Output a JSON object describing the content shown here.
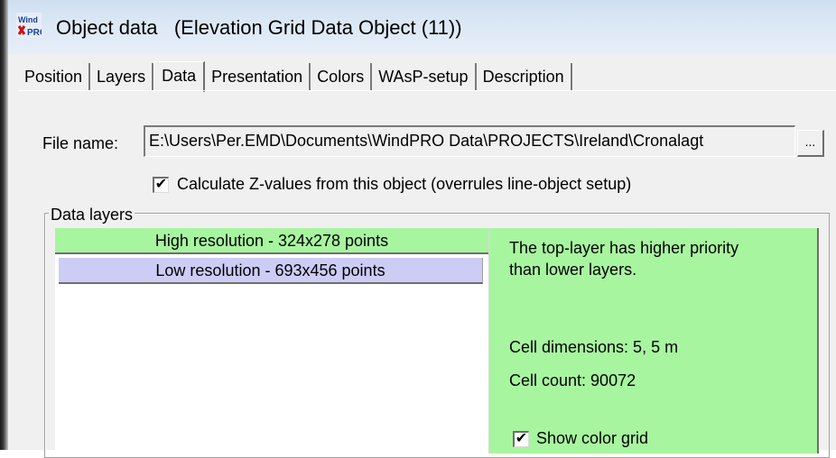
{
  "window": {
    "title": "Object data   (Elevation Grid Data Object (11))",
    "icon": "windpro-app-icon"
  },
  "tabs": [
    {
      "label": "Position",
      "active": false
    },
    {
      "label": "Layers",
      "active": false
    },
    {
      "label": "Data",
      "active": true
    },
    {
      "label": "Presentation",
      "active": false
    },
    {
      "label": "Colors",
      "active": false
    },
    {
      "label": "WAsP-setup",
      "active": false
    },
    {
      "label": "Description",
      "active": false
    }
  ],
  "file": {
    "label": "File name:",
    "value": "E:\\Users\\Per.EMD\\Documents\\WindPRO Data\\PROJECTS\\Ireland\\Cronalagt",
    "browse_label": "..."
  },
  "calculate_z": {
    "checked": true,
    "label": "Calculate Z-values from this object (overrules line-object setup)"
  },
  "data_layers": {
    "title": "Data layers",
    "layers": [
      {
        "label": "High resolution - 324x278 points",
        "color": "#a8f5a0"
      },
      {
        "label": "Low resolution - 693x456 points",
        "color": "#ccccf5"
      }
    ],
    "info": {
      "priority_line1": "The top-layer has higher priority",
      "priority_line2": "than lower layers.",
      "cell_dimensions": "Cell dimensions: 5, 5 m",
      "cell_count": "Cell count: 90072",
      "show_color_grid_label": "Show color grid",
      "show_color_grid_checked": true
    }
  },
  "check_mark": "✔",
  "colors": {
    "high_layer": "#a8f5a0",
    "low_layer": "#ccccf5",
    "info_panel": "#a8f5a0",
    "dialog_bg": "#f0f0f0"
  }
}
